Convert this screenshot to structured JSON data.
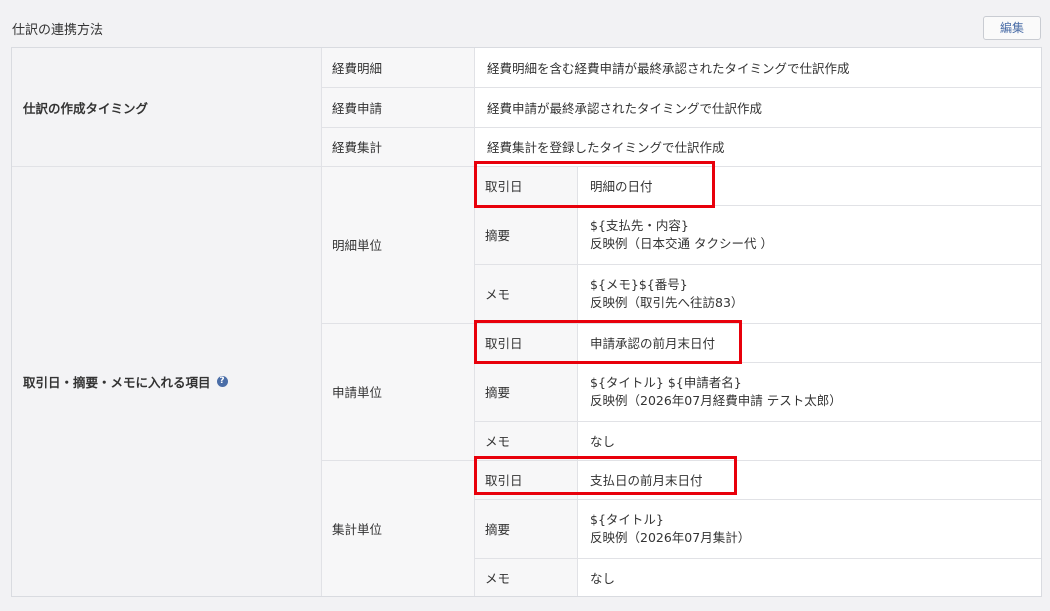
{
  "header": {
    "title": "仕訳の連携方法",
    "edit_label": "編集"
  },
  "timing": {
    "label": "仕訳の作成タイミング",
    "rows": [
      {
        "type": "経費明細",
        "desc": "経費明細を含む経費申請が最終承認されたタイミングで仕訳作成"
      },
      {
        "type": "経費申請",
        "desc": "経費申請が最終承認されたタイミングで仕訳作成"
      },
      {
        "type": "経費集計",
        "desc": "経費集計を登録したタイミングで仕訳作成"
      }
    ]
  },
  "items": {
    "label": "取引日・摘要・メモに入れる項目",
    "help_icon": "?",
    "groups": [
      {
        "unit": "明細単位",
        "date_label": "取引日",
        "date_value": "明細の日付",
        "summary_label": "摘要",
        "summary_value": "${支払先・内容}",
        "summary_example": "反映例（日本交通 タクシー代 ）",
        "memo_label": "メモ",
        "memo_value": "${メモ}${番号}",
        "memo_example": "反映例（取引先へ往訪83）"
      },
      {
        "unit": "申請単位",
        "date_label": "取引日",
        "date_value": "申請承認の前月末日付",
        "summary_label": "摘要",
        "summary_value": "${タイトル} ${申請者名}",
        "summary_example": "反映例（2026年07月経費申請 テスト太郎）",
        "memo_label": "メモ",
        "memo_value": "なし"
      },
      {
        "unit": "集計単位",
        "date_label": "取引日",
        "date_value": "支払日の前月末日付",
        "summary_label": "摘要",
        "summary_value": "${タイトル}",
        "summary_example": "反映例（2026年07月集計）",
        "memo_label": "メモ",
        "memo_value": "なし"
      }
    ]
  },
  "highlight_color": "#e8000b"
}
